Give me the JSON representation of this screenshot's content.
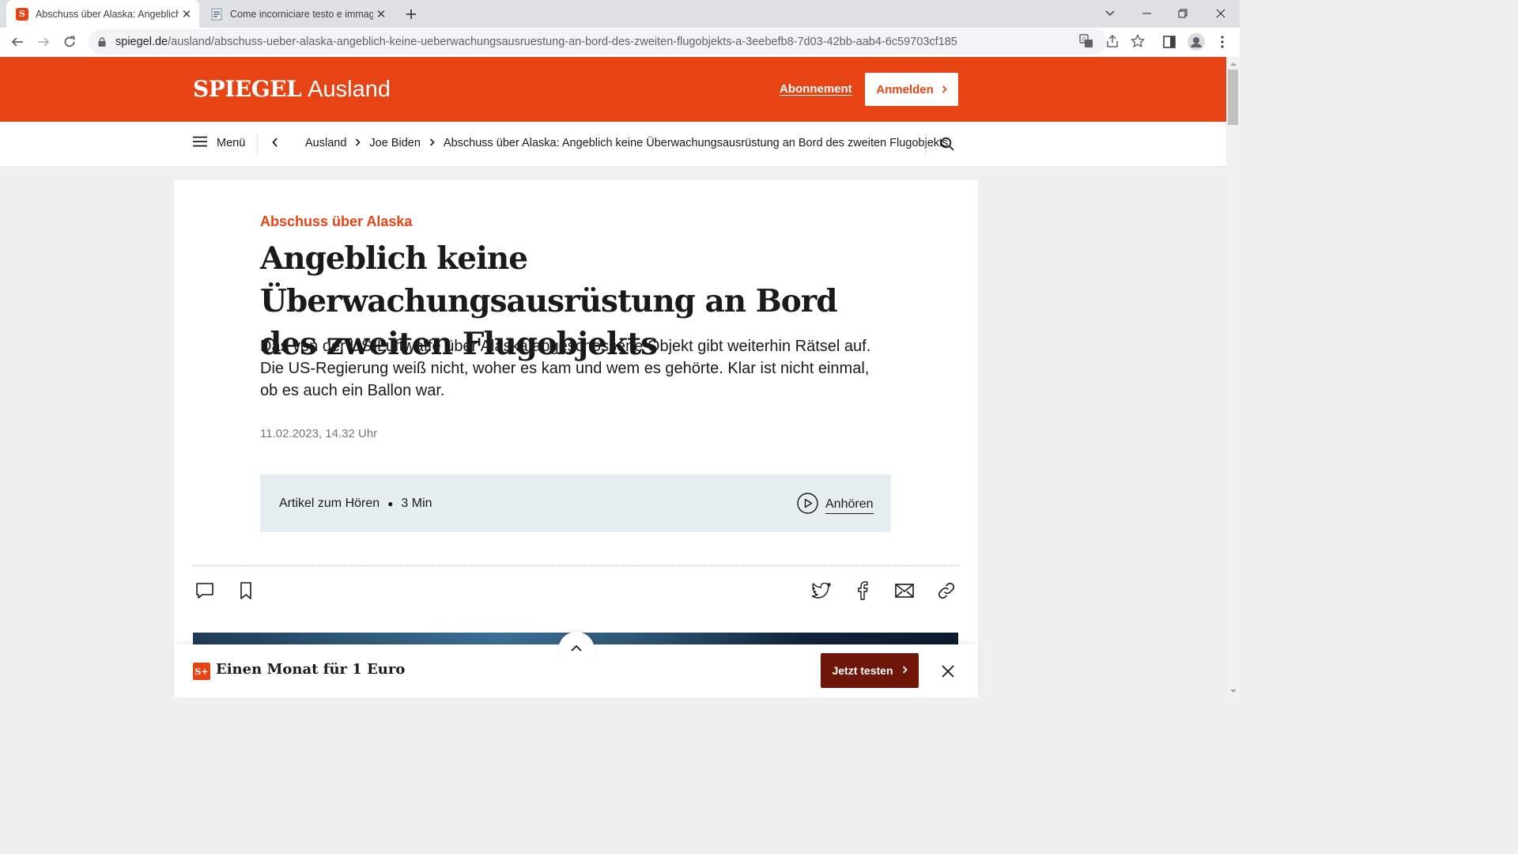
{
  "browser": {
    "tabs": [
      {
        "title": "Abschuss über Alaska: Angeblich",
        "favicon": "spiegel-s-icon",
        "active": true
      },
      {
        "title": "Come incorniciare testo e immag",
        "favicon": "word-doc-icon",
        "active": false
      }
    ],
    "url_host": "spiegel.de",
    "url_path": "/ausland/abschuss-ueber-alaska-angeblich-keine-ueberwachungsausruestung-an-bord-des-zweiten-flugobjekts-a-3eebefb8-7d03-42bb-aab4-6c59703cf185"
  },
  "site": {
    "brand": "SPIEGEL",
    "section": "Ausland",
    "subscription_link": "Abonnement",
    "login_button": "Anmelden",
    "brand_color": "#e64415"
  },
  "subnav": {
    "menu_label": "Menü",
    "breadcrumb": [
      "Ausland",
      "Joe Biden",
      "Abschuss über Alaska: Angeblich keine Überwachungsausrüstung an Bord des zweiten Flugobjekts"
    ]
  },
  "article": {
    "kicker": "Abschuss über Alaska",
    "headline": "Angeblich keine Überwachungsausrüstung an Bord des zweiten Flugobjekts",
    "teaser": "Das von der US-Luftwaffe über Alaska abgeschossene Objekt gibt weiterhin Rätsel auf. Die US-Regierung weiß nicht, woher es kam und wem es gehörte. Klar ist nicht einmal, ob es auch ein Ballon war.",
    "date": "11.02.2023, 14.32 Uhr",
    "audio": {
      "label": "Artikel zum Hören",
      "duration": "3 Min",
      "button": "Anhören"
    }
  },
  "promo": {
    "badge": "S+",
    "text": "Einen Monat für 1 Euro",
    "cta": "Jetzt testen"
  }
}
